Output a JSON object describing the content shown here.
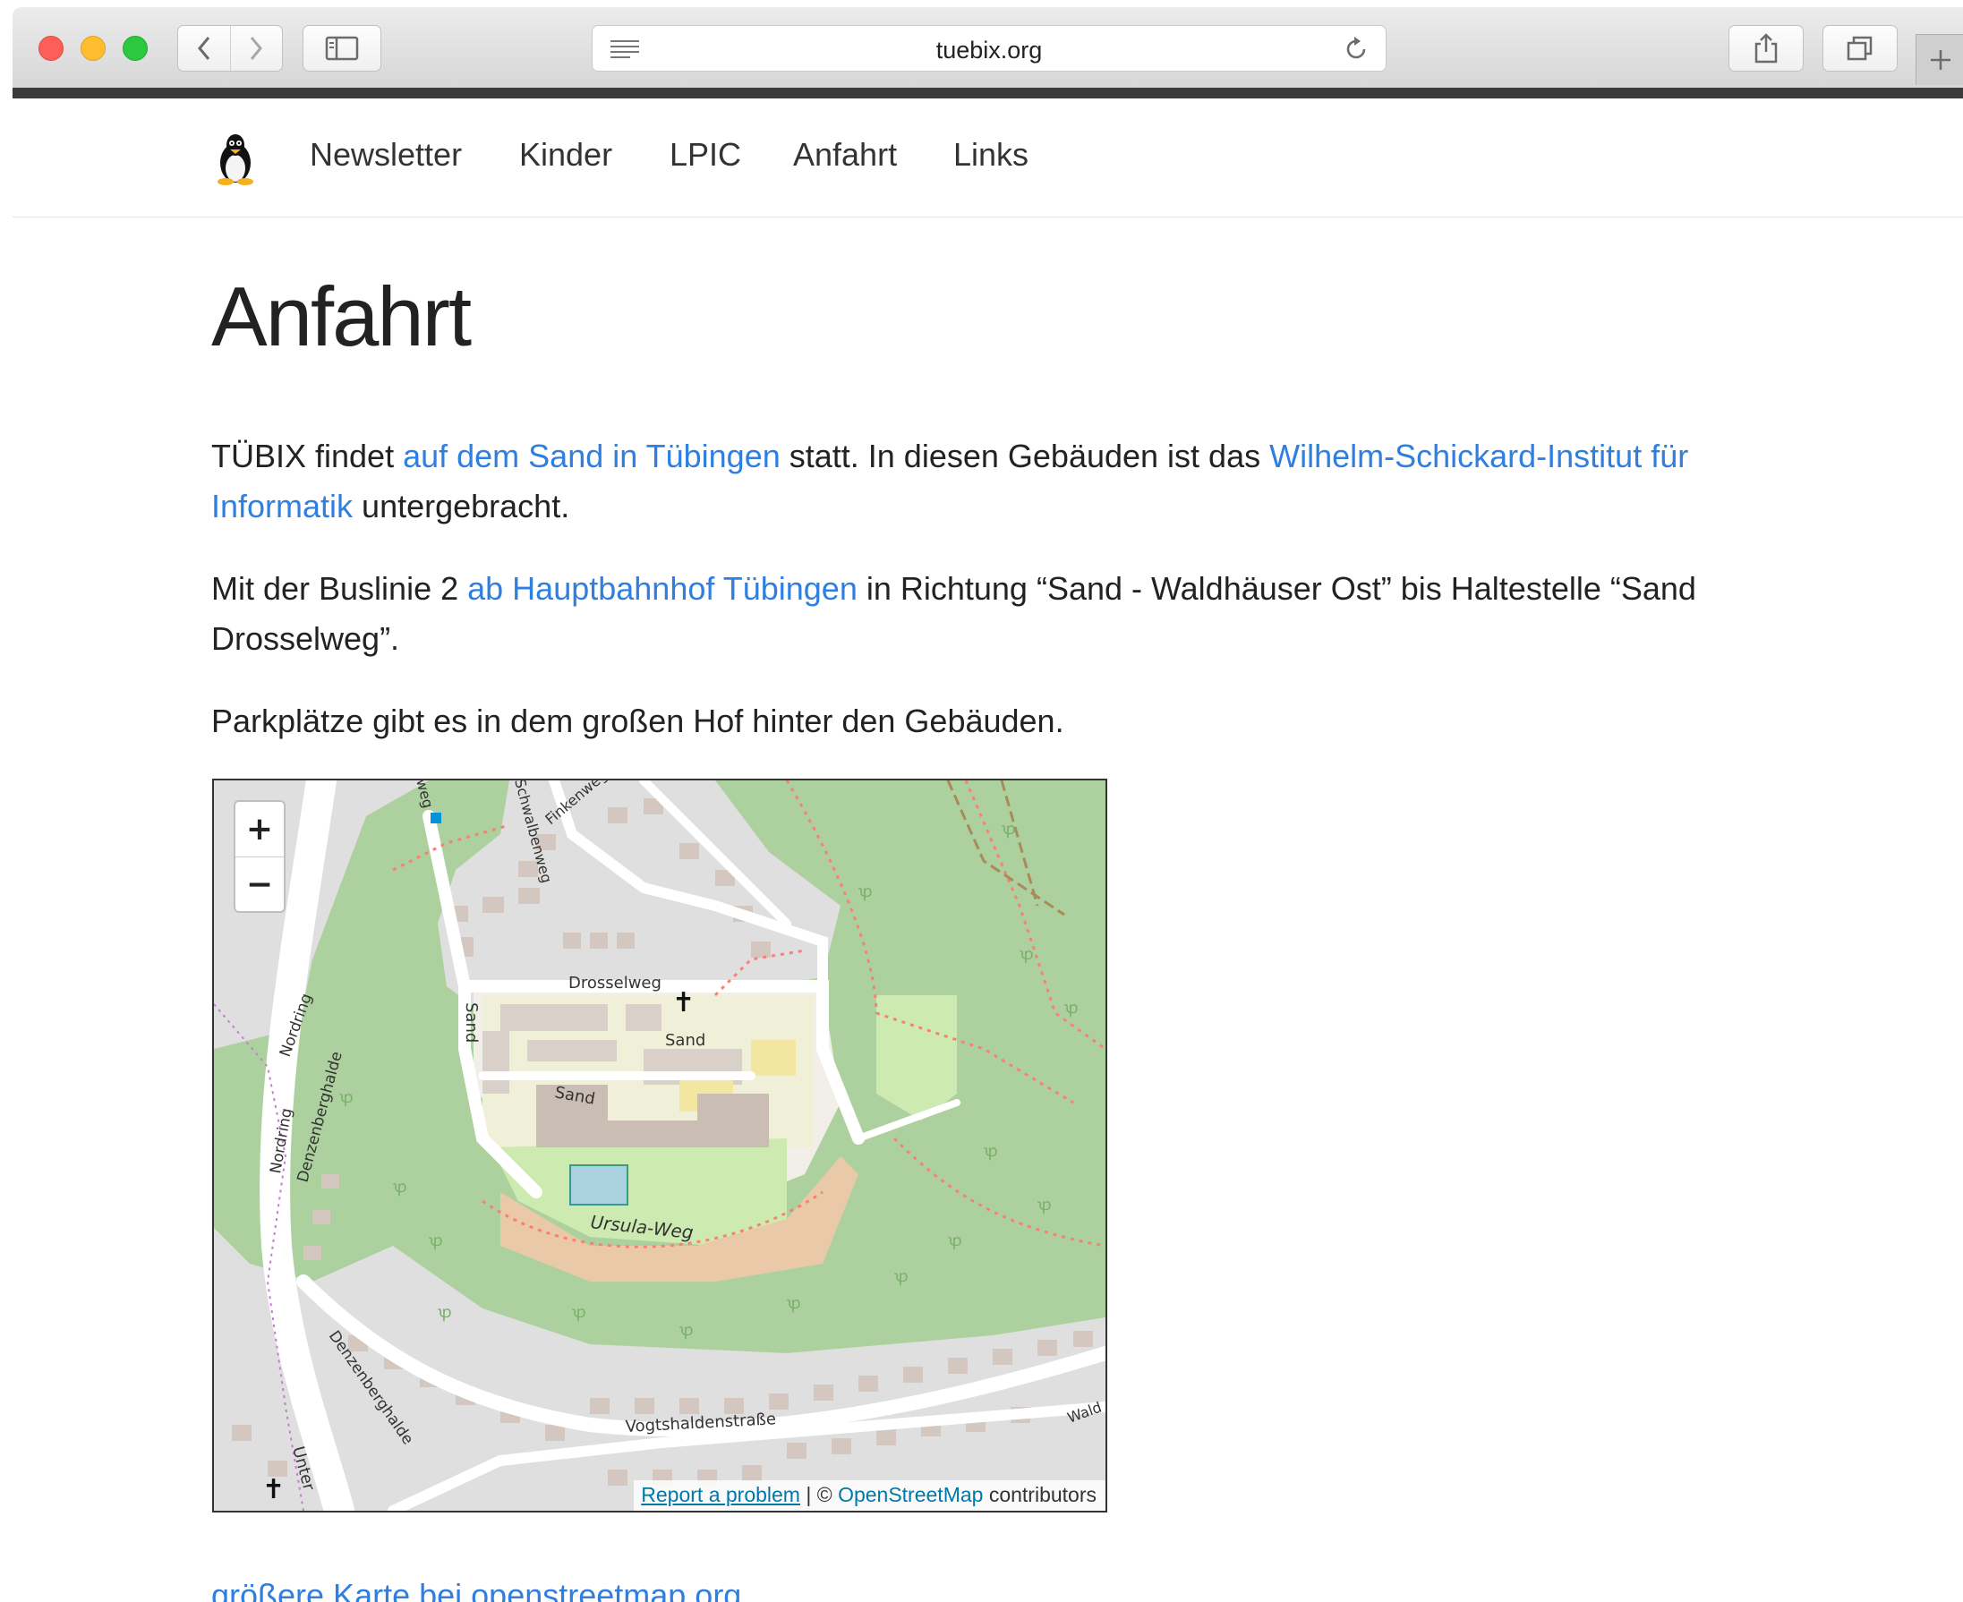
{
  "browser": {
    "url": "tuebix.org"
  },
  "nav": {
    "items": [
      "Newsletter",
      "Kinder",
      "LPIC",
      "Anfahrt",
      "Links"
    ]
  },
  "page": {
    "title": "Anfahrt",
    "p1": {
      "t1": "TÜBIX findet ",
      "link1": "auf dem Sand in Tübingen",
      "t2": " statt. In diesen Gebäuden ist das ",
      "link2": "Wilhelm-Schickard-Institut für Informatik",
      "t3": " untergebracht."
    },
    "p2": {
      "t1": "Mit der Buslinie 2 ",
      "link1": "ab Hauptbahnhof Tübingen",
      "t2": " in Richtung “Sand - Waldhäuser Ost” bis Haltestelle “Sand Drosselweg”."
    },
    "p3": "Parkplätze gibt es in dem großen Hof hinter den Gebäuden.",
    "map_link": "größere Karte bei openstreetmap.org"
  },
  "map": {
    "zoom_in": "+",
    "zoom_out": "−",
    "attribution": {
      "report": "Report a problem",
      "sep": " | © ",
      "osm": "OpenStreetMap",
      "suffix": " contributors"
    },
    "labels": {
      "drosselweg": "Drosselweg",
      "sand1": "Sand",
      "sand2": "Sand",
      "sand3": "Sand",
      "ursula": "Ursula-Weg",
      "vogtshalden": "Vogtshaldenstraße",
      "nordring1": "Nordring",
      "nordring2": "Nordring",
      "denzenberg1": "Denzenberghalde",
      "denzenberg2": "Denzenberghalde",
      "schwalben": "Schwalbenweg",
      "finken": "Finkenweg",
      "weg": "weg",
      "wald": "Wald",
      "unter": "Unter"
    },
    "colors": {
      "forest": "#add19e",
      "residential": "#e0dfdf",
      "campus": "#f2efe9",
      "university": "#f0f0d8",
      "building": "#d9d0c9",
      "road": "#ffffff",
      "path": "#fa8072"
    }
  }
}
